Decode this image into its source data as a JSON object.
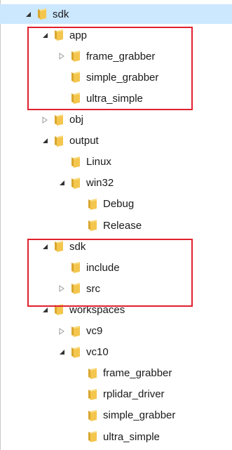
{
  "tree": {
    "items": [
      {
        "label": "sdk",
        "depth": 0,
        "expander": "expanded",
        "selected": true
      },
      {
        "label": "app",
        "depth": 1,
        "expander": "expanded"
      },
      {
        "label": "frame_grabber",
        "depth": 2,
        "expander": "collapsed"
      },
      {
        "label": "simple_grabber",
        "depth": 2,
        "expander": "none"
      },
      {
        "label": "ultra_simple",
        "depth": 2,
        "expander": "none"
      },
      {
        "label": "obj",
        "depth": 1,
        "expander": "collapsed"
      },
      {
        "label": "output",
        "depth": 1,
        "expander": "expanded"
      },
      {
        "label": "Linux",
        "depth": 2,
        "expander": "none"
      },
      {
        "label": "win32",
        "depth": 2,
        "expander": "expanded"
      },
      {
        "label": "Debug",
        "depth": 3,
        "expander": "none"
      },
      {
        "label": "Release",
        "depth": 3,
        "expander": "none"
      },
      {
        "label": "sdk",
        "depth": 1,
        "expander": "expanded"
      },
      {
        "label": "include",
        "depth": 2,
        "expander": "none"
      },
      {
        "label": "src",
        "depth": 2,
        "expander": "collapsed"
      },
      {
        "label": "workspaces",
        "depth": 1,
        "expander": "expanded"
      },
      {
        "label": "vc9",
        "depth": 2,
        "expander": "collapsed"
      },
      {
        "label": "vc10",
        "depth": 2,
        "expander": "expanded"
      },
      {
        "label": "frame_grabber",
        "depth": 3,
        "expander": "none"
      },
      {
        "label": "rplidar_driver",
        "depth": 3,
        "expander": "none"
      },
      {
        "label": "simple_grabber",
        "depth": 3,
        "expander": "none"
      },
      {
        "label": "ultra_simple",
        "depth": 3,
        "expander": "none"
      }
    ]
  },
  "annotations": {
    "box_color": "#e0202e"
  },
  "colors": {
    "selection": "#cce8ff",
    "folder_body": "#f4c64e",
    "folder_dark": "#d9a62e",
    "text": "#1a1a1a"
  },
  "icons": {
    "folder": "folder-icon",
    "expanded": "expanded-arrow-icon",
    "collapsed": "collapsed-arrow-icon"
  }
}
